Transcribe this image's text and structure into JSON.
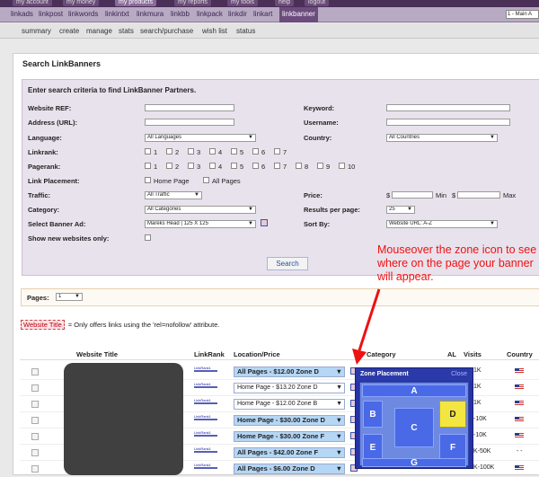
{
  "top_tabs": [
    {
      "label": "my account",
      "active": false
    },
    {
      "label": "my money",
      "active": false
    },
    {
      "label": "my products",
      "active": true
    },
    {
      "label": "my reports",
      "active": false
    },
    {
      "label": "my tools",
      "active": false
    },
    {
      "label": "help",
      "active": false
    },
    {
      "label": "logout",
      "active": false
    }
  ],
  "nav_main": [
    "linkads",
    "linkpost",
    "linkwords",
    "linkintxt",
    "linkmura",
    "linkbb",
    "linkpack",
    "linkdir",
    "linkart",
    "linkbanner"
  ],
  "nav_main_active": "linkbanner",
  "site_select": "1 - Main A",
  "nav_sub": [
    "summary",
    "create",
    "manage",
    "stats",
    "search/purchase",
    "wish list",
    "status"
  ],
  "panel_title": "Search LinkBanners",
  "form": {
    "header": "Enter search criteria to find LinkBanner Partners.",
    "website_ref": "Website REF:",
    "address": "Address (URL):",
    "language": "Language:",
    "language_value": "All Languages",
    "linkrank": "Linkrank:",
    "linkrank_opts": [
      "1",
      "2",
      "3",
      "4",
      "5",
      "6",
      "7"
    ],
    "pagerank": "Pagerank:",
    "pagerank_opts": [
      "1",
      "2",
      "3",
      "4",
      "5",
      "6",
      "7",
      "8",
      "9",
      "10"
    ],
    "link_placement": "Link Placement:",
    "placement_home": "Home Page",
    "placement_all": "All Pages",
    "traffic": "Traffic:",
    "traffic_value": "All Traffic",
    "category": "Category:",
    "category_value": "All Categories",
    "banner_ad": "Select Banner Ad:",
    "banner_ad_value": "Mareks Head | 125 X 125",
    "new_only": "Show new websites only:",
    "keyword": "Keyword:",
    "username": "Username:",
    "country": "Country:",
    "country_value": "All Countries",
    "price": "Price:",
    "dollar": "$",
    "min": "Min",
    "max": "Max",
    "results": "Results per page:",
    "results_value": "25",
    "sort": "Sort By:",
    "sort_value": "Website URL: A-Z",
    "search": "Search"
  },
  "pages_label": "Pages:",
  "pages_value": "1",
  "note_tag": "Website Title",
  "note_text": "= Only offers links using the 'rel=nofollow' attribute.",
  "table": {
    "headers": [
      "Website Title",
      "LinkRank",
      "Location/Price",
      "Category",
      "AL",
      "Visits",
      "Country"
    ],
    "rows": [
      {
        "loc": "All Pages - $12.00 Zone D",
        "hl": true,
        "visits": "1K",
        "country": "us"
      },
      {
        "loc": "Home Page - $13.20 Zone D",
        "hl": false,
        "visits": "1K",
        "country": "us"
      },
      {
        "loc": "Home Page - $12.00 Zone B",
        "hl": false,
        "visits": "1K",
        "country": "us"
      },
      {
        "loc": "Home Page - $30.00 Zone D",
        "hl": true,
        "visits": "-10K",
        "country": "us"
      },
      {
        "loc": "Home Page - $30.00 Zone F",
        "hl": true,
        "visits": "-10K",
        "country": "us"
      },
      {
        "loc": "All Pages - $42.00 Zone F",
        "hl": true,
        "visits": "K-50K",
        "country": "- -"
      },
      {
        "loc": "All Pages - $6.00 Zone D",
        "hl": true,
        "visits": "K-100K",
        "country": "us"
      }
    ]
  },
  "zone_popup": {
    "title": "Zone Placement",
    "close": "Close",
    "zones": [
      "A",
      "B",
      "C",
      "D",
      "E",
      "F",
      "G"
    ],
    "highlight": "D"
  },
  "callout": "Mouseover the zone icon to see where on the page your banner will appear.",
  "colors": {
    "nav_dark": "#4a2f57",
    "nav_active": "#6b4c7c",
    "form_bg": "#e8e2ec",
    "callout": "#e11111",
    "zone_highlight": "#f3e640"
  }
}
